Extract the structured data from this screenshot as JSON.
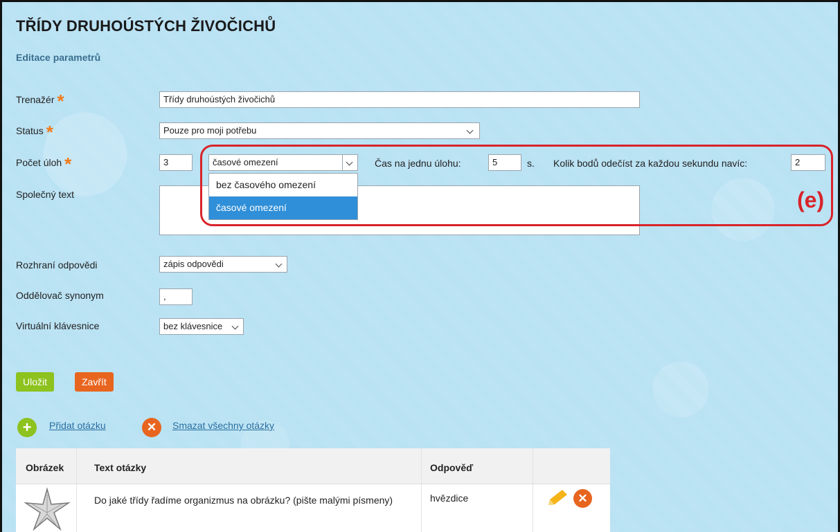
{
  "page": {
    "title": "TŘÍDY DRUHOÚSTÝCH ŽIVOČICHŮ",
    "subtitle": "Editace parametrů"
  },
  "form": {
    "trenazer_label": "Trenažér",
    "trenazer_value": "Třídy druhoústých živočichů",
    "status_label": "Status",
    "status_value": "Pouze pro moji potřebu",
    "pocet_uloh_label": "Počet úloh",
    "pocet_uloh_value": "3",
    "time_select_value": "časové omezení",
    "time_select_options": [
      "bez časového omezení",
      "časové omezení"
    ],
    "cas_label": "Čas na jednu úlohu:",
    "cas_value": "5",
    "cas_unit": "s.",
    "body_label": "Kolik bodů odečíst za každou sekundu navíc:",
    "body_value": "2",
    "spolecny_text_label": "Společný text",
    "rozhrani_label": "Rozhraní odpovědi",
    "rozhrani_value": "zápis odpovědi",
    "oddelovac_label": "Oddělovač synonym",
    "oddelovac_value": ",",
    "klavesnice_label": "Virtuální klávesnice",
    "klavesnice_value": "bez klávesnice"
  },
  "annotation": "(e)",
  "buttons": {
    "save": "Uložit",
    "close": "Zavřít"
  },
  "links": {
    "add_question": "Přidat otázku",
    "delete_all": "Smazat všechny otázky"
  },
  "table": {
    "headers": [
      "Obrázek",
      "Text otázky",
      "Odpověď"
    ],
    "rows": [
      {
        "text": "Do jaké třídy řadíme organizmus na obrázku? (pište malými písmeny)",
        "answer": "hvězdice"
      }
    ]
  },
  "colors": {
    "accent_green": "#8dc21f",
    "accent_orange": "#e8651f",
    "highlight_red": "#d8232a",
    "selected_blue": "#2f8fd8"
  }
}
